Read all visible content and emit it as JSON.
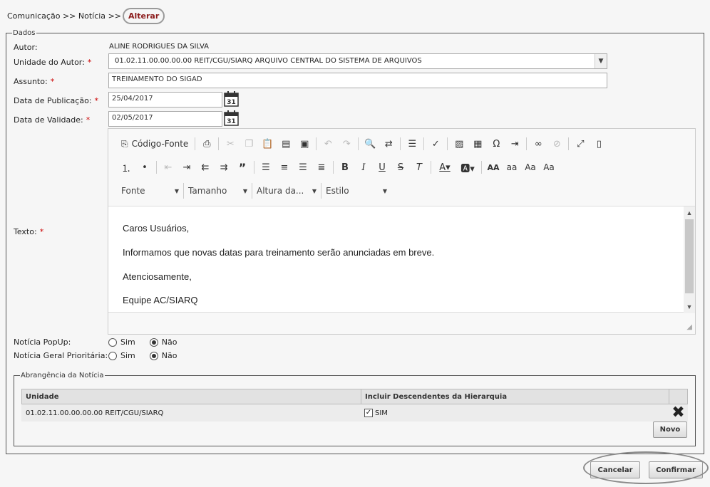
{
  "breadcrumb": {
    "root": "Comunicação",
    "sep1": ">>",
    "section": "Notícia",
    "sep2": ">>",
    "current": "Alterar"
  },
  "form": {
    "legend": "Dados",
    "autor": {
      "label": "Autor:",
      "value": "ALINE RODRIGUES DA SILVA"
    },
    "unidade": {
      "label": "Unidade do Autor:",
      "required": "*",
      "value": "01.02.11.00.00.00.00 REIT/CGU/SIARQ ARQUIVO CENTRAL DO SISTEMA DE ARQUIVOS"
    },
    "assunto": {
      "label": "Assunto:",
      "required": "*",
      "value": "TREINAMENTO DO SIGAD"
    },
    "data_pub": {
      "label": "Data de Publicação:",
      "required": "*",
      "value": "25/04/2017"
    },
    "data_val": {
      "label": "Data de Validade:",
      "required": "*",
      "value": "02/05/2017"
    },
    "calendar_day": "31",
    "texto": {
      "label": "Texto:",
      "required": "*"
    },
    "editor": {
      "source_label": "Código-Fonte",
      "font_combo": "Fonte",
      "size_combo": "Tamanho",
      "height_combo": "Altura da...",
      "style_combo": "Estilo",
      "lines": [
        "Caros Usuários,",
        "Informamos que novas datas para treinamento serão anunciadas em breve.",
        "Atenciosamente,",
        "Equipe AC/SIARQ"
      ]
    },
    "popup": {
      "label": "Notícia PopUp:",
      "sim": "Sim",
      "nao": "Não",
      "selected": "Não"
    },
    "prioritaria": {
      "label": "Notícia Geral Prioritária:",
      "sim": "Sim",
      "nao": "Não",
      "selected": "Não"
    }
  },
  "abrangencia": {
    "legend": "Abrangência da Notícia",
    "columns": [
      "Unidade",
      "Incluir Descendentes da Hierarquia"
    ],
    "rows": [
      {
        "unidade": "01.02.11.00.00.00.00 REIT/CGU/SIARQ",
        "descendentes": "SIM",
        "checked": true
      }
    ],
    "novo_label": "Novo"
  },
  "actions": {
    "cancelar": "Cancelar",
    "confirmar": "Confirmar"
  }
}
